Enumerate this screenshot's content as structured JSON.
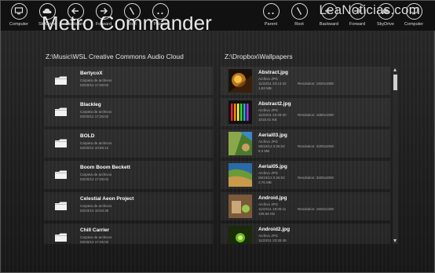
{
  "watermark": "LeaNoticias.com",
  "app_title": "Metro Commander",
  "left_commands": [
    {
      "icon": "computer-icon",
      "label": "Computer"
    },
    {
      "icon": "cloud-icon",
      "label": "SkyDrive"
    },
    {
      "icon": "back-icon",
      "label": "Backward"
    },
    {
      "icon": "forward-icon",
      "label": "Forward"
    },
    {
      "icon": "root-icon",
      "label": "Root"
    },
    {
      "icon": "parent-icon",
      "label": "Parent"
    }
  ],
  "right_commands": [
    {
      "icon": "parent-icon",
      "label": "Parent"
    },
    {
      "icon": "root-icon",
      "label": "Root"
    },
    {
      "icon": "back-icon",
      "label": "Backward"
    },
    {
      "icon": "forward-icon",
      "label": "Forward"
    },
    {
      "icon": "cloud-icon",
      "label": "SkyDrive"
    },
    {
      "icon": "computer-icon",
      "label": "Computer"
    }
  ],
  "left_pane": {
    "path": "Z:\\Music\\WSL Creative Commons Audio Cloud",
    "items": [
      {
        "name": "BertycoX",
        "type": "Carpeta de archivos",
        "date": "02/20/12 17:25:02"
      },
      {
        "name": "Blackleg",
        "type": "Carpeta de archivos",
        "date": "02/20/12 17:25:02"
      },
      {
        "name": "BOLD",
        "type": "Carpeta de archivos",
        "date": "02/20/12 10:55:12"
      },
      {
        "name": "Boom Boom Beckett",
        "type": "Carpeta de archivos",
        "date": "02/20/12 17:25:02"
      },
      {
        "name": "Celestial Aeon Project",
        "type": "Carpeta de archivos",
        "date": "02/23/12 18:04:38"
      },
      {
        "name": "Chill Carrier",
        "type": "Carpeta de archivos",
        "date": "02/20/12 17:25:02"
      }
    ]
  },
  "right_pane": {
    "path": "Z:\\Dropbox\\Wallpapers",
    "items": [
      {
        "name": "Abstract.jpg",
        "type": "Archivo JPG",
        "date": "11/23/11 23:14:42",
        "size": "1.63 MB",
        "resolution": "Resolution: 1920x1080",
        "thumb": "dark-gold"
      },
      {
        "name": "Abstract2.jpg",
        "type": "Archivo JPG",
        "date": "11/23/11 23:29:20",
        "size": "1015.01 KB",
        "resolution": "Resolution: 1680x1050",
        "thumb": "rainbow"
      },
      {
        "name": "Aerial03.jpg",
        "type": "Archivo JPG",
        "date": "06/23/12 0:26:02",
        "size": "5.3 MB",
        "resolution": "Resolution: 3200x2000",
        "thumb": "aerial-green"
      },
      {
        "name": "Aerial05.jpg",
        "type": "Archivo JPG",
        "date": "06/23/12 0:26:02",
        "size": "2.76 MB",
        "resolution": "Resolution: 3200x2000",
        "thumb": "aerial-blue"
      },
      {
        "name": "Android.jpg",
        "type": "Archivo JPG",
        "date": "11/23/11 18:05:11",
        "size": "109.66 KB",
        "resolution": "Resolution: 1920x1200",
        "thumb": "android-brown"
      },
      {
        "name": "Android2.jpg",
        "type": "Archivo JPG",
        "date": "11/23/11 23:25:48",
        "size": "",
        "resolution": "",
        "thumb": "android-green"
      }
    ]
  }
}
